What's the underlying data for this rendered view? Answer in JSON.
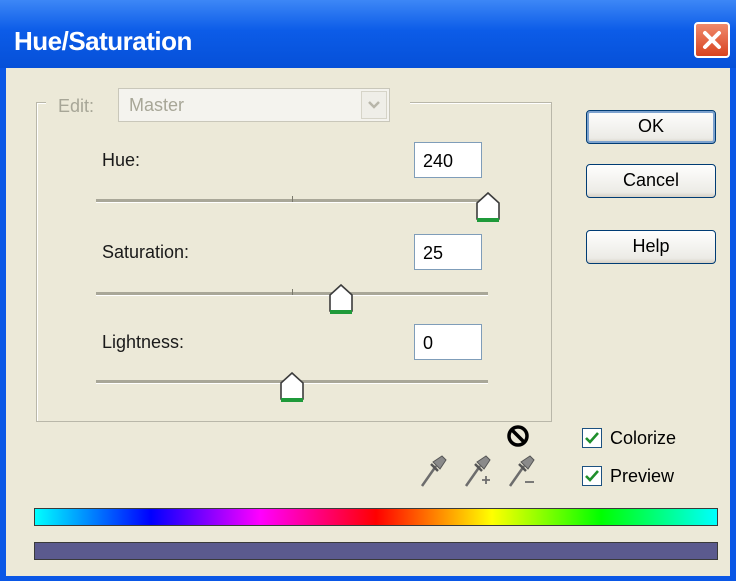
{
  "window": {
    "title": "Hue/Saturation",
    "close_icon": "close-icon"
  },
  "edit": {
    "label": "Edit:",
    "value": "Master",
    "arrow_icon": "chevron-down-icon",
    "enabled": false
  },
  "sliders": [
    {
      "label": "Hue:",
      "value": "240",
      "min": -180,
      "max": 180,
      "numeric": 240
    },
    {
      "label": "Saturation:",
      "value": "25",
      "min": -100,
      "max": 100,
      "numeric": 25
    },
    {
      "label": "Lightness:",
      "value": "0",
      "min": -100,
      "max": 100,
      "numeric": 0
    }
  ],
  "buttons": {
    "ok": "OK",
    "cancel": "Cancel",
    "help": "Help"
  },
  "checkboxes": {
    "colorize": {
      "label": "Colorize",
      "checked": true
    },
    "preview": {
      "label": "Preview",
      "checked": true
    }
  },
  "tools": [
    "eyedropper-icon",
    "eyedropper-plus-icon",
    "eyedropper-minus-icon",
    "no-symbol-icon"
  ],
  "colors": {
    "title_bar": "#0a57e6",
    "dialog_bg": "#ece9d8",
    "result_bar": "#5b5a8e",
    "thumb_green": "#1f9a3a",
    "check_green": "#1f8f2b"
  }
}
